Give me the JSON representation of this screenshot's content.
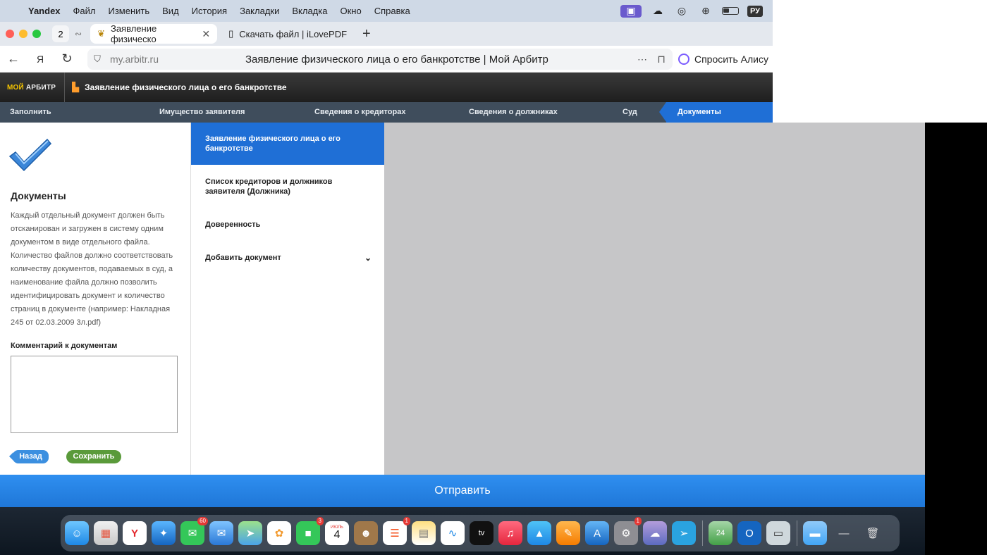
{
  "menubar": {
    "items": [
      "Yandex",
      "Файл",
      "Изменить",
      "Вид",
      "История",
      "Закладки",
      "Вкладка",
      "Окно",
      "Справка"
    ],
    "lang": "РУ"
  },
  "tabs": {
    "count": "2",
    "items": [
      {
        "label": "Заявление физическо"
      },
      {
        "label": "Скачать файл | iLovePDF"
      }
    ]
  },
  "address": {
    "url": "my.arbitr.ru",
    "page_title": "Заявление физического лица о его банкротстве | Мой Арбитр",
    "alice": "Спросить Алису"
  },
  "site": {
    "logo_a": "МОЙ ",
    "logo_b": "АРБИТР",
    "header_title": "Заявление физического лица о его банкротстве"
  },
  "steps": [
    "Заполнить",
    "Имущество заявителя",
    "Сведения о кредиторах",
    "Сведения о должниках",
    "Суд",
    "Документы"
  ],
  "left": {
    "title": "Документы",
    "text": "Каждый отдельный документ должен быть отсканирован и загружен в систему одним документом в виде отдельного файла. Количество файлов должно соответствовать количеству документов, подаваемых в суд, а наименование файла должно позволить идентифицировать документ и количество страниц в документе (например: Накладная 245 от 02.03.2009 3л.pdf)",
    "comment_label": "Комментарий к документам",
    "comment_value": "",
    "back": "Назад",
    "save": "Сохранить"
  },
  "docs": [
    "Заявление физического лица о его банкротстве",
    "Список кредиторов и должников заявителя (Должника)",
    "Доверенность",
    "Добавить документ"
  ],
  "send": "Отправить",
  "dock": {
    "badges": {
      "messages": "60",
      "facetime": "3",
      "reminders": "1",
      "settings": "1"
    },
    "calendar_month": "ИЮЛЬ",
    "calendar_day": "4",
    "tv_label": "tv",
    "news_day": "24"
  },
  "colors": {
    "accent": "#1f6fd6",
    "save_green": "#5a9a3a",
    "header_dark": "#2a2a2a",
    "stepnav": "#3f4d5c"
  }
}
